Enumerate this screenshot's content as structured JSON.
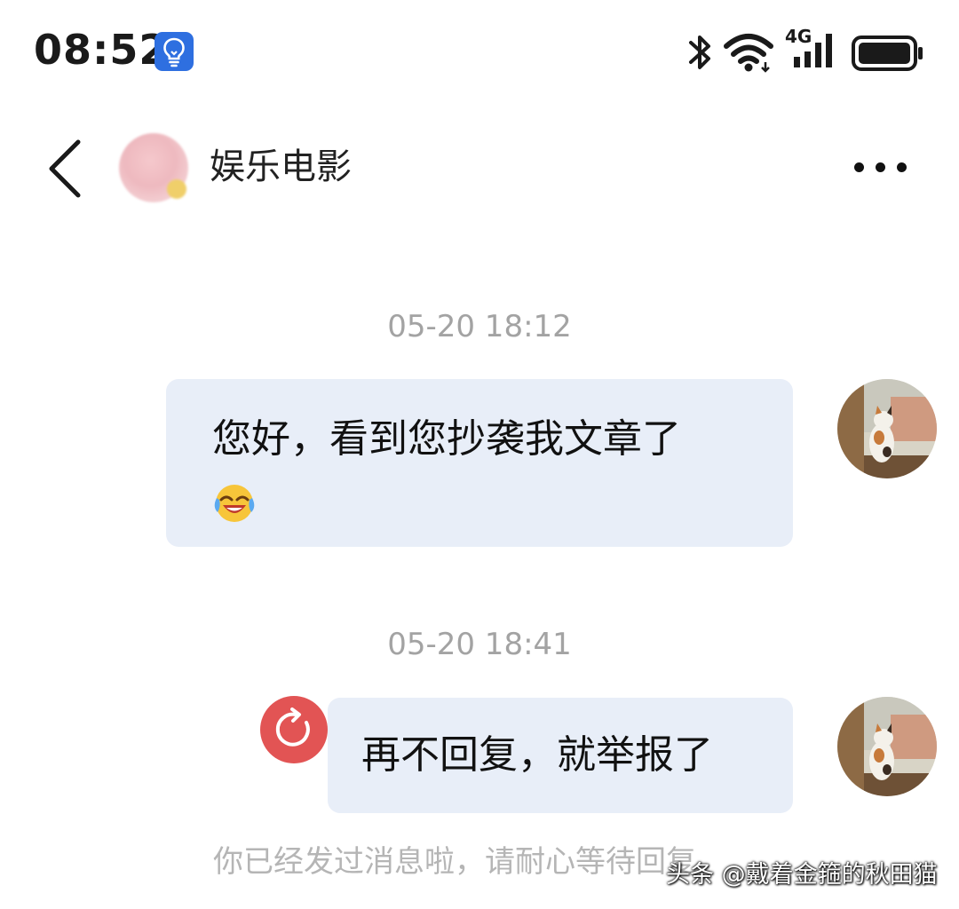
{
  "status_bar": {
    "time": "08:52",
    "network": "4G",
    "icons": [
      "bulb-notification-icon",
      "bluetooth-icon",
      "wifi-icon",
      "signal-icon",
      "battery-icon"
    ]
  },
  "header": {
    "contact_name": "娱乐电影",
    "back_icon": "chevron-left-icon",
    "more_icon": "more-dots-icon"
  },
  "messages": [
    {
      "timestamp": "05-20 18:12",
      "text": "您好，看到您抄袭我文章了",
      "emoji": "laughing-crying-emoji"
    },
    {
      "timestamp": "05-20 18:41",
      "text": "再不回复，就举报了",
      "status": "resend-icon"
    }
  ],
  "hint": "你已经发过消息啦，请耐心等待回复",
  "watermark": "头条 @戴着金箍的秋田猫",
  "colors": {
    "bubble": "#e8eef8",
    "timestamp": "#a3a3a3",
    "retry": "#e25454",
    "notification": "#2e6fe0"
  }
}
